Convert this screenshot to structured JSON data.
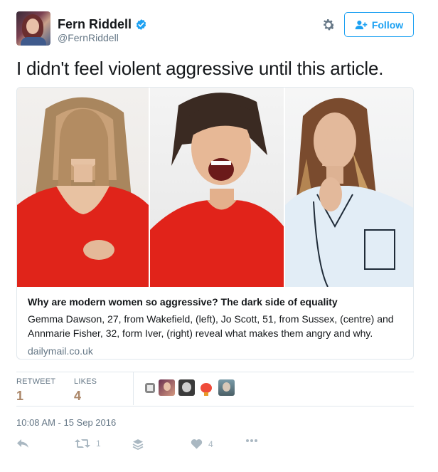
{
  "author": {
    "name": "Fern Riddell",
    "handle": "@FernRiddell",
    "verified": true
  },
  "header": {
    "follow_label": "Follow"
  },
  "tweet": {
    "text": "I didn't feel violent aggressive until this article."
  },
  "card": {
    "title": "Why are modern women so aggressive? The dark side of equality",
    "description": "Gemma Dawson, 27, from Wakefield, (left), Jo Scott, 51, from Sussex, (centre) and Annmarie Fisher, 32, form Iver, (right) reveal what makes them angry and why.",
    "domain": "dailymail.co.uk"
  },
  "stats": {
    "retweets_label": "RETWEET",
    "retweets_value": "1",
    "likes_label": "LIKES",
    "likes_value": "4"
  },
  "timestamp": "10:08 AM - 15 Sep 2016",
  "actions": {
    "retweet_count": "1",
    "like_count": "4"
  },
  "colors": {
    "accent": "#1da1f2",
    "stat_value": "#ab8668",
    "muted": "#657786",
    "action_icon": "#aab8c2"
  },
  "icons": [
    "verified-badge-icon",
    "gear-icon",
    "follow-user-icon",
    "reply-icon",
    "retweet-icon",
    "buffer-icon",
    "heart-icon",
    "more-icon"
  ]
}
